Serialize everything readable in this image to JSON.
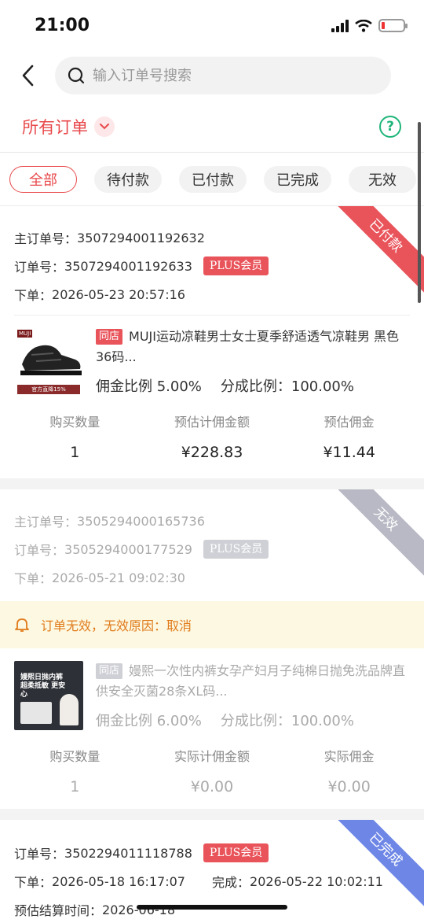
{
  "status_bar": {
    "time": "21:00"
  },
  "search": {
    "placeholder": "输入订单号搜索"
  },
  "filter": {
    "title": "所有订单"
  },
  "tabs": [
    {
      "label": "全部",
      "active": true
    },
    {
      "label": "待付款",
      "active": false
    },
    {
      "label": "已付款",
      "active": false
    },
    {
      "label": "已完成",
      "active": false
    },
    {
      "label": "无效",
      "active": false
    }
  ],
  "orders": [
    {
      "ribbon": "已付款",
      "ribbon_color": "#e9545b",
      "main_order_label": "主订单号：",
      "main_order_no": "3507294001192632",
      "order_label": "订单号：",
      "order_no": "3507294001192633",
      "badge": "PLUS会员",
      "badge_color": "#e9545b",
      "placed_label": "下单：",
      "placed_time": "2026-05-23 20:57:16",
      "shop_tag": "同店",
      "product_title": "MUJI运动凉鞋男士女士夏季舒适透气凉鞋男 黑色 36码...",
      "thumb_brand": "MUJI",
      "thumb_banner": "官方直降15%",
      "commission_rate": "佣金比例 5.00%",
      "share_rate": "分成比例：100.00%",
      "stats": [
        {
          "label": "购买数量",
          "value": "1"
        },
        {
          "label": "预估计佣金额",
          "value": "¥228.83"
        },
        {
          "label": "预估佣金",
          "value": "¥11.44"
        }
      ]
    },
    {
      "ribbon": "无效",
      "ribbon_color": "#b8b9c4",
      "main_order_label": "主订单号：",
      "main_order_no": "3505294000165736",
      "order_label": "订单号：",
      "order_no": "3505294000177529",
      "badge": "PLUS会员",
      "badge_color": "#cfd0d6",
      "placed_label": "下单：",
      "placed_time": "2026-05-21 09:02:30",
      "notice": "订单无效，无效原因：取消",
      "shop_tag": "同店",
      "product_title": "嫚熙一次性内裤女孕产妇月子纯棉日抛免洗品牌直供安全灭菌28条XL码...",
      "thumb_text": "嫚熙日抛内裤 超柔抵敏 更安心",
      "commission_rate": "佣金比例 6.00%",
      "share_rate": "分成比例：100.00%",
      "stats": [
        {
          "label": "购买数量",
          "value": "1"
        },
        {
          "label": "实际计佣金额",
          "value": "¥0.00"
        },
        {
          "label": "实际佣金",
          "value": "¥0.00"
        }
      ]
    },
    {
      "ribbon": "已完成",
      "ribbon_color": "#6e87e6",
      "order_label": "订单号：",
      "order_no": "3502294011118788",
      "badge": "PLUS会员",
      "badge_color": "#e9545b",
      "placed_label": "下单：",
      "placed_time": "2026-05-18 16:17:07",
      "done_label": "完成：",
      "done_time": "2026-05-22 10:02:11",
      "settle_label": "预估结算时间：",
      "settle_time": "2026-06-18"
    }
  ]
}
